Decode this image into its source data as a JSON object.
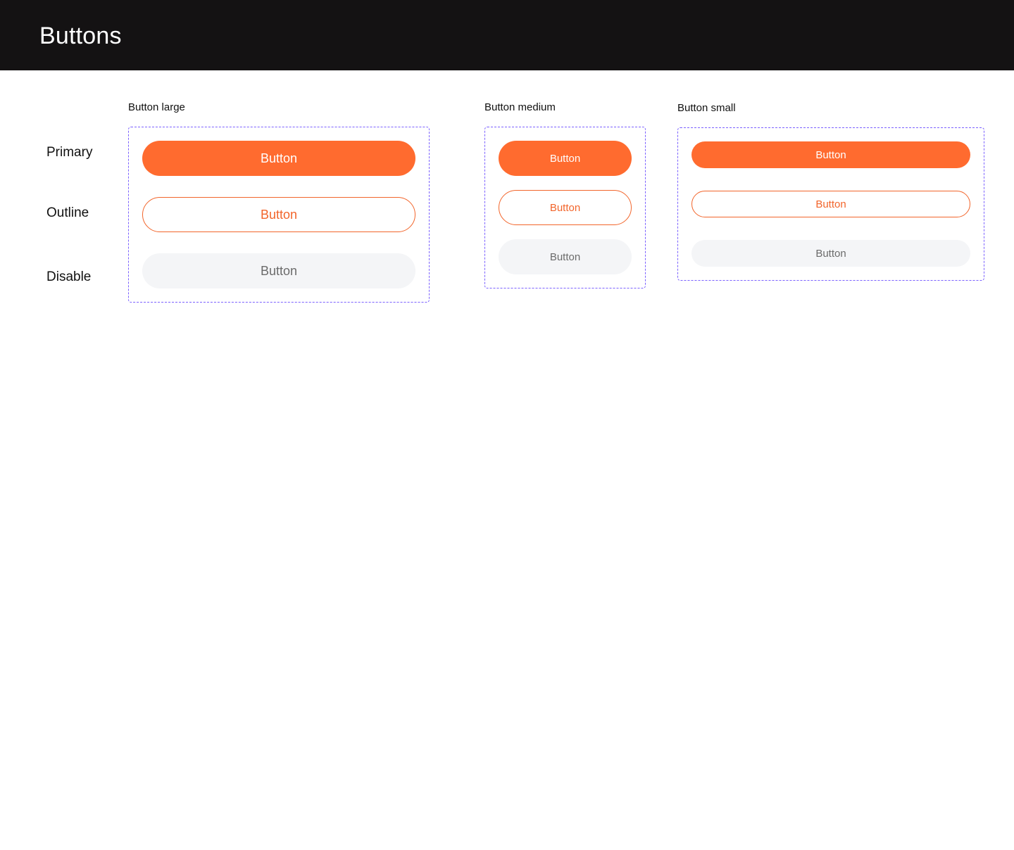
{
  "header": {
    "title": "Buttons"
  },
  "rows": {
    "primary": "Primary",
    "outline": "Outline",
    "disable": "Disable"
  },
  "groups": {
    "large": {
      "title": "Button large"
    },
    "medium": {
      "title": "Button medium"
    },
    "small": {
      "title": "Button small"
    }
  },
  "buttons": {
    "label": "Button"
  },
  "colors": {
    "header_bg": "#141213",
    "accent": "#FF6B2F",
    "outline": "#F2652B",
    "disabled_bg": "#F4F5F7",
    "disabled_text": "#6B6B6B",
    "frame_border": "#7B61FF"
  }
}
